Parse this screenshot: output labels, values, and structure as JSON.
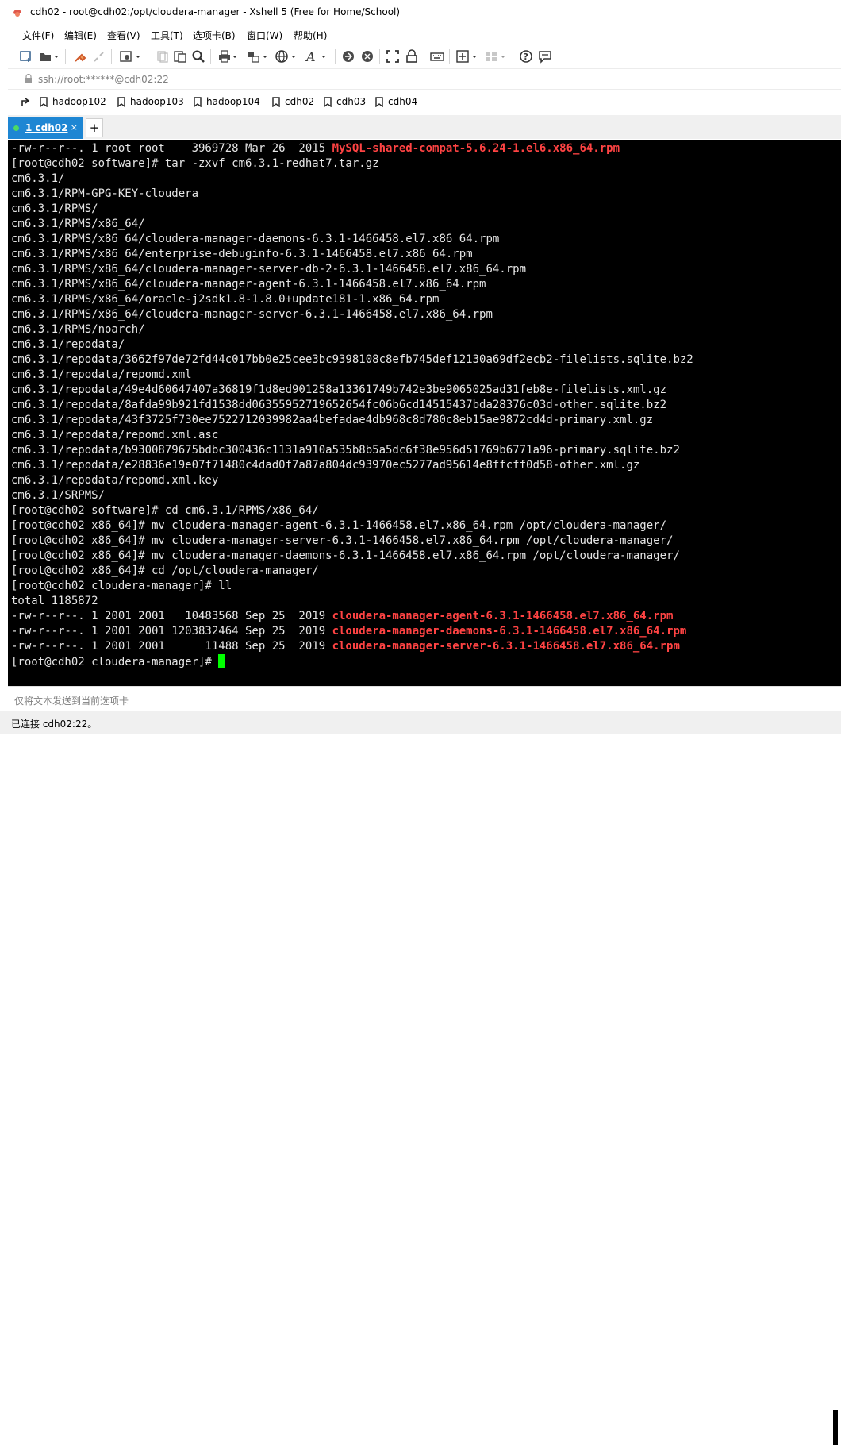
{
  "window": {
    "title": "cdh02 - root@cdh02:/opt/cloudera-manager - Xshell 5 (Free for Home/School)"
  },
  "menu": [
    {
      "label": "文件(F)"
    },
    {
      "label": "编辑(E)"
    },
    {
      "label": "查看(V)"
    },
    {
      "label": "工具(T)"
    },
    {
      "label": "选项卡(B)"
    },
    {
      "label": "窗口(W)"
    },
    {
      "label": "帮助(H)"
    }
  ],
  "address": {
    "text": "ssh://root:******@cdh02:22"
  },
  "links": [
    {
      "label": "hadoop102"
    },
    {
      "label": "hadoop103"
    },
    {
      "label": "hadoop104"
    },
    {
      "label": "cdh02"
    },
    {
      "label": "cdh03"
    },
    {
      "label": "cdh04"
    }
  ],
  "tabs": [
    {
      "label": "1 cdh02",
      "close": "×"
    }
  ],
  "new_tab_label": "+",
  "terminal": {
    "lines": [
      {
        "text": "-rw-r--r--. 1 root root    3969728 Mar 26  2015 ",
        "red": "MySQL-shared-compat-5.6.24-1.el6.x86_64.rpm"
      },
      {
        "text": "[root@cdh02 software]# tar -zxvf cm6.3.1-redhat7.tar.gz"
      },
      {
        "text": "cm6.3.1/"
      },
      {
        "text": "cm6.3.1/RPM-GPG-KEY-cloudera"
      },
      {
        "text": "cm6.3.1/RPMS/"
      },
      {
        "text": "cm6.3.1/RPMS/x86_64/"
      },
      {
        "text": "cm6.3.1/RPMS/x86_64/cloudera-manager-daemons-6.3.1-1466458.el7.x86_64.rpm"
      },
      {
        "text": "cm6.3.1/RPMS/x86_64/enterprise-debuginfo-6.3.1-1466458.el7.x86_64.rpm"
      },
      {
        "text": "cm6.3.1/RPMS/x86_64/cloudera-manager-server-db-2-6.3.1-1466458.el7.x86_64.rpm"
      },
      {
        "text": "cm6.3.1/RPMS/x86_64/cloudera-manager-agent-6.3.1-1466458.el7.x86_64.rpm"
      },
      {
        "text": "cm6.3.1/RPMS/x86_64/oracle-j2sdk1.8-1.8.0+update181-1.x86_64.rpm"
      },
      {
        "text": "cm6.3.1/RPMS/x86_64/cloudera-manager-server-6.3.1-1466458.el7.x86_64.rpm"
      },
      {
        "text": "cm6.3.1/RPMS/noarch/"
      },
      {
        "text": "cm6.3.1/repodata/"
      },
      {
        "text": "cm6.3.1/repodata/3662f97de72fd44c017bb0e25cee3bc9398108c8efb745def12130a69df2ecb2-filelists.sqlite.bz2"
      },
      {
        "text": "cm6.3.1/repodata/repomd.xml"
      },
      {
        "text": "cm6.3.1/repodata/49e4d60647407a36819f1d8ed901258a13361749b742e3be9065025ad31feb8e-filelists.xml.gz"
      },
      {
        "text": "cm6.3.1/repodata/8afda99b921fd1538dd06355952719652654fc06b6cd14515437bda28376c03d-other.sqlite.bz2"
      },
      {
        "text": "cm6.3.1/repodata/43f3725f730ee7522712039982aa4befadae4db968c8d780c8eb15ae9872cd4d-primary.xml.gz"
      },
      {
        "text": "cm6.3.1/repodata/repomd.xml.asc"
      },
      {
        "text": "cm6.3.1/repodata/b9300879675bdbc300436c1131a910a535b8b5a5dc6f38e956d51769b6771a96-primary.sqlite.bz2"
      },
      {
        "text": "cm6.3.1/repodata/e28836e19e07f71480c4dad0f7a87a804dc93970ec5277ad95614e8ffcff0d58-other.xml.gz"
      },
      {
        "text": "cm6.3.1/repodata/repomd.xml.key"
      },
      {
        "text": "cm6.3.1/SRPMS/"
      },
      {
        "text": "[root@cdh02 software]# cd cm6.3.1/RPMS/x86_64/"
      },
      {
        "text": "[root@cdh02 x86_64]# mv cloudera-manager-agent-6.3.1-1466458.el7.x86_64.rpm /opt/cloudera-manager/"
      },
      {
        "text": "[root@cdh02 x86_64]# mv cloudera-manager-server-6.3.1-1466458.el7.x86_64.rpm /opt/cloudera-manager/"
      },
      {
        "text": "[root@cdh02 x86_64]# mv cloudera-manager-daemons-6.3.1-1466458.el7.x86_64.rpm /opt/cloudera-manager/"
      },
      {
        "text": "[root@cdh02 x86_64]# cd /opt/cloudera-manager/"
      },
      {
        "text": "[root@cdh02 cloudera-manager]# ll"
      },
      {
        "text": "total 1185872"
      },
      {
        "text": "-rw-r--r--. 1 2001 2001   10483568 Sep 25  2019 ",
        "red": "cloudera-manager-agent-6.3.1-1466458.el7.x86_64.rpm"
      },
      {
        "text": "-rw-r--r--. 1 2001 2001 1203832464 Sep 25  2019 ",
        "red": "cloudera-manager-daemons-6.3.1-1466458.el7.x86_64.rpm"
      },
      {
        "text": "-rw-r--r--. 1 2001 2001      11488 Sep 25  2019 ",
        "red": "cloudera-manager-server-6.3.1-1466458.el7.x86_64.rpm"
      },
      {
        "text": "[root@cdh02 cloudera-manager]# ",
        "cursor": true
      }
    ]
  },
  "input": {
    "placeholder": "仅将文本发送到当前选项卡"
  },
  "status": {
    "text": "已连接 cdh02:22。"
  },
  "colors": {
    "terminal_bg": "#000000",
    "terminal_fg": "#e5e5e5",
    "highlight_red": "#ff4343",
    "cursor_green": "#00ff00",
    "tab_active": "#1e86d3"
  },
  "icons": [
    "app-logo-icon",
    "new-session-icon",
    "open-folder-icon",
    "connect-icon",
    "disconnect-icon",
    "properties-icon",
    "copy-icon",
    "paste-icon",
    "find-icon",
    "print-icon",
    "transfer-icon",
    "globe-icon",
    "font-icon",
    "xftp-icon",
    "xmanager-icon",
    "fullscreen-icon",
    "lock-icon",
    "keyboard-icon",
    "add-icon",
    "layout-icon",
    "help-icon",
    "chat-icon",
    "bookmark-icon"
  ]
}
